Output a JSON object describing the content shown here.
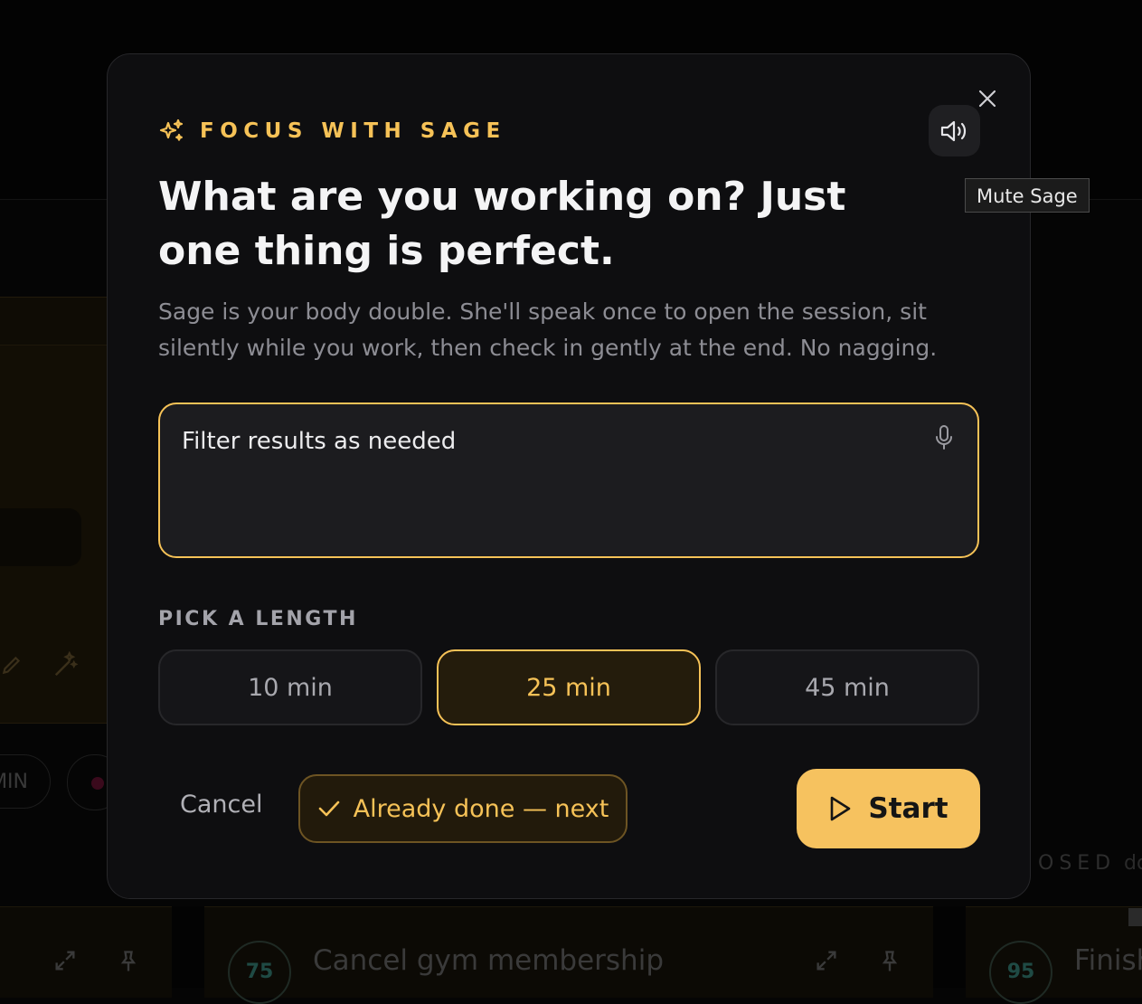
{
  "background": {
    "chip_label": "MIN",
    "closed_label": "OSED",
    "closed_suffix": "do",
    "cards": [
      {
        "score": "75",
        "title": "Cancel gym membership"
      },
      {
        "score": "95",
        "title": "Finish"
      }
    ]
  },
  "modal": {
    "eyebrow": "FOCUS WITH SAGE",
    "headline": "What are you working on? Just one thing is perfect.",
    "description": "Sage is your body double. She'll speak once to open the session, sit silently while you work, then check in gently at the end. No nagging.",
    "task_value": "Filter results as needed",
    "length_label": "PICK A LENGTH",
    "lengths": [
      {
        "label": "10 min",
        "selected": false
      },
      {
        "label": "25 min",
        "selected": true
      },
      {
        "label": "45 min",
        "selected": false
      }
    ],
    "cancel_label": "Cancel",
    "done_label": "Already done — next",
    "start_label": "Start",
    "mute_tooltip": "Mute Sage"
  },
  "colors": {
    "accent": "#f6c257",
    "modal_bg": "#0e0e10",
    "input_bg": "#1c1c1f",
    "start_bg": "#f6c25f"
  },
  "icons": {
    "eyebrow": "sparkles-icon",
    "mute": "speaker-icon",
    "close": "close-icon",
    "mic": "microphone-icon",
    "done": "check-icon",
    "start": "play-icon"
  }
}
